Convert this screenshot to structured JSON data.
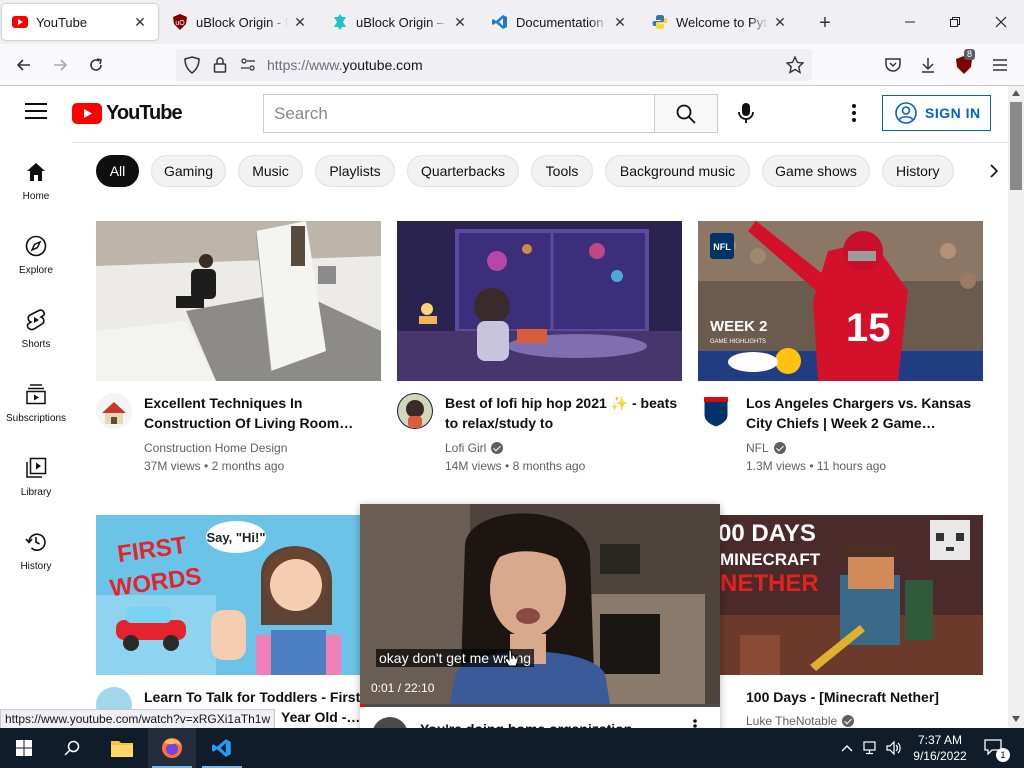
{
  "browser": {
    "tabs": [
      {
        "title": "YouTube",
        "icon": "youtube-favicon-icon"
      },
      {
        "title": "uBlock Origin - Free",
        "icon": "ublock-favicon-icon"
      },
      {
        "title": "uBlock Origin – Get",
        "icon": "puzzle-favicon-icon"
      },
      {
        "title": "Documentation for",
        "icon": "vscode-favicon-icon"
      },
      {
        "title": "Welcome to Python",
        "icon": "python-favicon-icon"
      }
    ],
    "url_scheme": "https://www.",
    "url_host": "youtube.com",
    "ublock_badge": "8"
  },
  "youtube": {
    "logo_text": "YouTube",
    "search_placeholder": "Search",
    "sign_in_label": "SIGN IN",
    "rail": [
      {
        "label": "Home",
        "icon": "home-icon"
      },
      {
        "label": "Explore",
        "icon": "compass-icon"
      },
      {
        "label": "Shorts",
        "icon": "shorts-icon"
      },
      {
        "label": "Subscriptions",
        "icon": "subscriptions-icon"
      },
      {
        "label": "Library",
        "icon": "library-icon"
      },
      {
        "label": "History",
        "icon": "history-icon"
      }
    ],
    "chips": [
      "All",
      "Gaming",
      "Music",
      "Playlists",
      "Quarterbacks",
      "Tools",
      "Background music",
      "Game shows",
      "History"
    ],
    "videos": [
      {
        "title": "Excellent Techniques In Construction Of Living Room…",
        "channel": "Construction Home Design",
        "verified": false,
        "views": "37M views",
        "age": "2 months ago"
      },
      {
        "title": "Best of lofi hip hop 2021 ✨ - beats to relax/study to",
        "channel": "Lofi Girl",
        "verified": true,
        "views": "14M views",
        "age": "8 months ago"
      },
      {
        "title": "Los Angeles Chargers vs. Kansas City Chiefs | Week 2 Game…",
        "channel": "NFL",
        "verified": true,
        "views": "1.3M views",
        "age": "11 hours ago"
      },
      {
        "title": "Learn To Talk for Toddlers - First",
        "title_line2": "Year Old -…",
        "channel": "",
        "verified": false,
        "views": "",
        "age": ""
      },
      {
        "title": "You're doing home organization",
        "channel": "",
        "verified": false,
        "views": "",
        "age": ""
      },
      {
        "title": "100 Days - [Minecraft Nether]",
        "channel": "Luke TheNotable",
        "verified": true,
        "views": "",
        "age": ""
      }
    ],
    "thumb_texts": {
      "nfl_week": "WEEK 2",
      "nfl_sub": "GAME HIGHLIGHTS",
      "nfl_logo": "NFL",
      "player_number": "15",
      "first_words_1": "FIRST",
      "first_words_2": "WORDS",
      "say_hi": "Say, \"Hi!\"",
      "mc_line1": "00 DAYS",
      "mc_line2": "MINECRAFT",
      "mc_line3": "NETHER"
    },
    "preview": {
      "caption": "okay don't get me wrong",
      "time": "0:01 / 22:10",
      "progress": 0.01
    }
  },
  "status_link": "https://www.youtube.com/watch?v=xRGXi1aTh1w",
  "taskbar": {
    "time": "7:37 AM",
    "date": "9/16/2022",
    "notification_count": "1"
  }
}
